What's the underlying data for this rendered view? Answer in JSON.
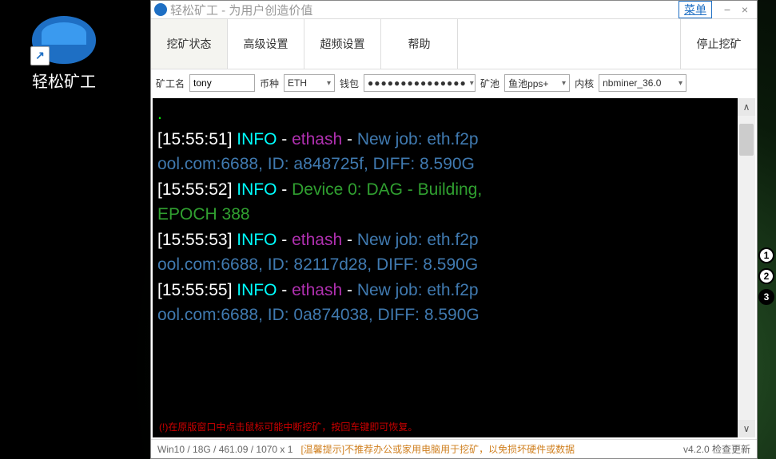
{
  "desktop": {
    "icon_label": "轻松矿工"
  },
  "window": {
    "title": "轻松矿工 - 为用户创造价值",
    "menu": "菜单",
    "minimize": "−",
    "close": "×"
  },
  "tabs": {
    "status": "挖矿状态",
    "advanced": "高级设置",
    "overclock": "超频设置",
    "help": "帮助",
    "stop": "停止挖矿"
  },
  "form": {
    "name_label": "矿工名",
    "name_value": "tony",
    "coin_label": "币种",
    "coin_value": "ETH",
    "wallet_label": "钱包",
    "wallet_value": "●●●●●●●●●●●●●●●",
    "pool_label": "矿池",
    "pool_value": "鱼池pps+",
    "kernel_label": "内核",
    "kernel_value": "nbminer_36.0"
  },
  "terminal": {
    "dot": ".",
    "l1a": "[15:55:51] ",
    "l1b": "INFO",
    "l1c": " - ",
    "l1d_eth": "ethash",
    "l1d_sep": " - ",
    "l1d_job": "New job: eth.f2p",
    "l2a": "ool.com:6688, ID: a848725f, DIFF: 8.590G",
    "l3a": "[15:55:52] ",
    "l3b": "INFO",
    "l3c": " - ",
    "l3d": "Device 0: DAG - Building,",
    "l4a": " EPOCH 388",
    "l5a": "[15:55:53] ",
    "l5b": "INFO",
    "l5c": " - ",
    "l5d_eth": "ethash",
    "l5d_sep": " - ",
    "l5d_job": "New job: eth.f2p",
    "l6a": "ool.com:6688, ID: 82117d28, DIFF: 8.590G",
    "l7a": "[15:55:55] ",
    "l7b": "INFO",
    "l7c": " - ",
    "l7d_eth": "ethash",
    "l7d_sep": " - ",
    "l7d_job": "New job: eth.f2p",
    "l8a": "ool.com:6688, ID: 0a874038, DIFF: 8.590G",
    "warn": "(!)在原版窗口中点击鼠标可能中断挖矿，按回车键即可恢复。"
  },
  "scroll": {
    "up": "∧",
    "down": "∨"
  },
  "badges": {
    "b1": "1",
    "b2": "2",
    "b3": "3"
  },
  "status": {
    "sys": "Win10  / 18G / 461.09 / 1070 x 1",
    "tip": "[温馨提示]不推荐办公或家用电脑用于挖矿，以免损坏硬件或数据",
    "ver": "v4.2.0 检查更新"
  }
}
